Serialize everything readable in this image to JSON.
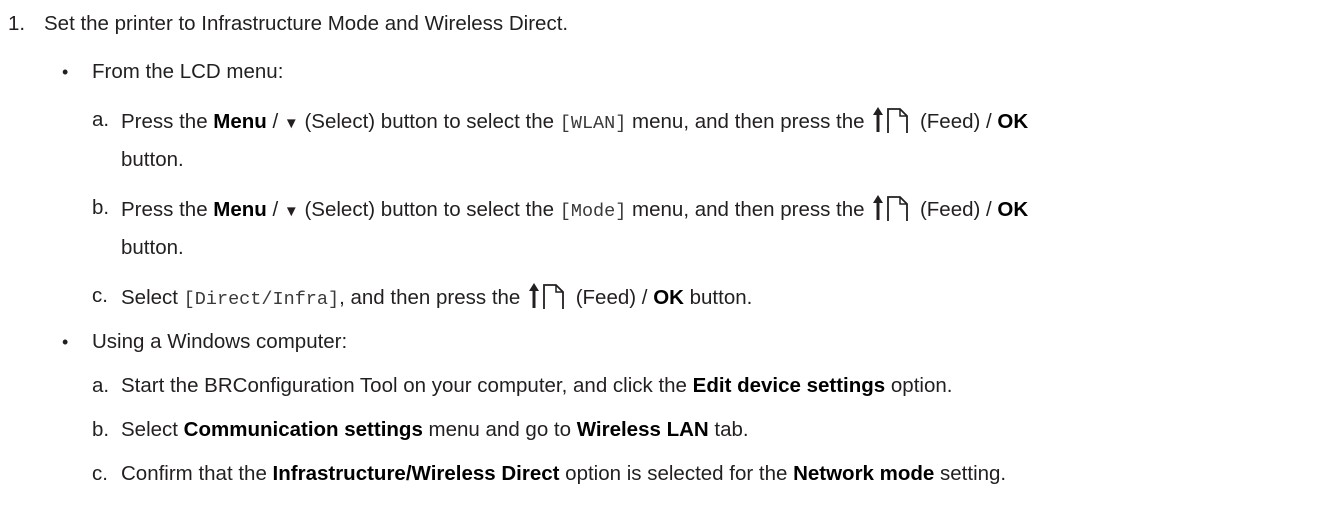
{
  "step1": {
    "number": "1.",
    "text": "Set the printer to Infrastructure Mode and Wireless Direct."
  },
  "lcd": {
    "bullet": "•",
    "heading": "From the LCD menu:",
    "a": {
      "letter": "a.",
      "t1": "Press the ",
      "b1": "Menu",
      "t2": " / ",
      "arrow": "▼",
      "t3": " (Select) button to select the ",
      "code": "[WLAN]",
      "t4": " menu, and then press the ",
      "t5": " (Feed) / ",
      "b2": "OK",
      "cont": "button."
    },
    "b": {
      "letter": "b.",
      "t1": "Press the ",
      "b1": "Menu",
      "t2": " / ",
      "arrow": "▼",
      "t3": " (Select) button to select the ",
      "code": "[Mode]",
      "t4": " menu, and then press the ",
      "t5": " (Feed) / ",
      "b2": "OK",
      "cont": "button."
    },
    "c": {
      "letter": "c.",
      "t1": "Select ",
      "code": "[Direct/Infra]",
      "t2": ", and then press the ",
      "t3": " (Feed) / ",
      "b1": "OK",
      "t4": " button."
    }
  },
  "windows": {
    "bullet": "•",
    "heading": "Using a Windows computer:",
    "a": {
      "letter": "a.",
      "t1": "Start the BRConfiguration Tool on your computer, and click the ",
      "b1": "Edit device settings",
      "t2": " option."
    },
    "b": {
      "letter": "b.",
      "t1": "Select ",
      "b1": "Communication settings",
      "t2": " menu and go to ",
      "b2": "Wireless LAN",
      "t3": " tab."
    },
    "c": {
      "letter": "c.",
      "t1": "Confirm that the ",
      "b1": "Infrastructure/Wireless Direct",
      "t2": " option is selected for the ",
      "b2": "Network mode",
      "t3": " setting."
    }
  },
  "icons": {
    "feed": "feed-button-icon",
    "color": "#231f20"
  }
}
